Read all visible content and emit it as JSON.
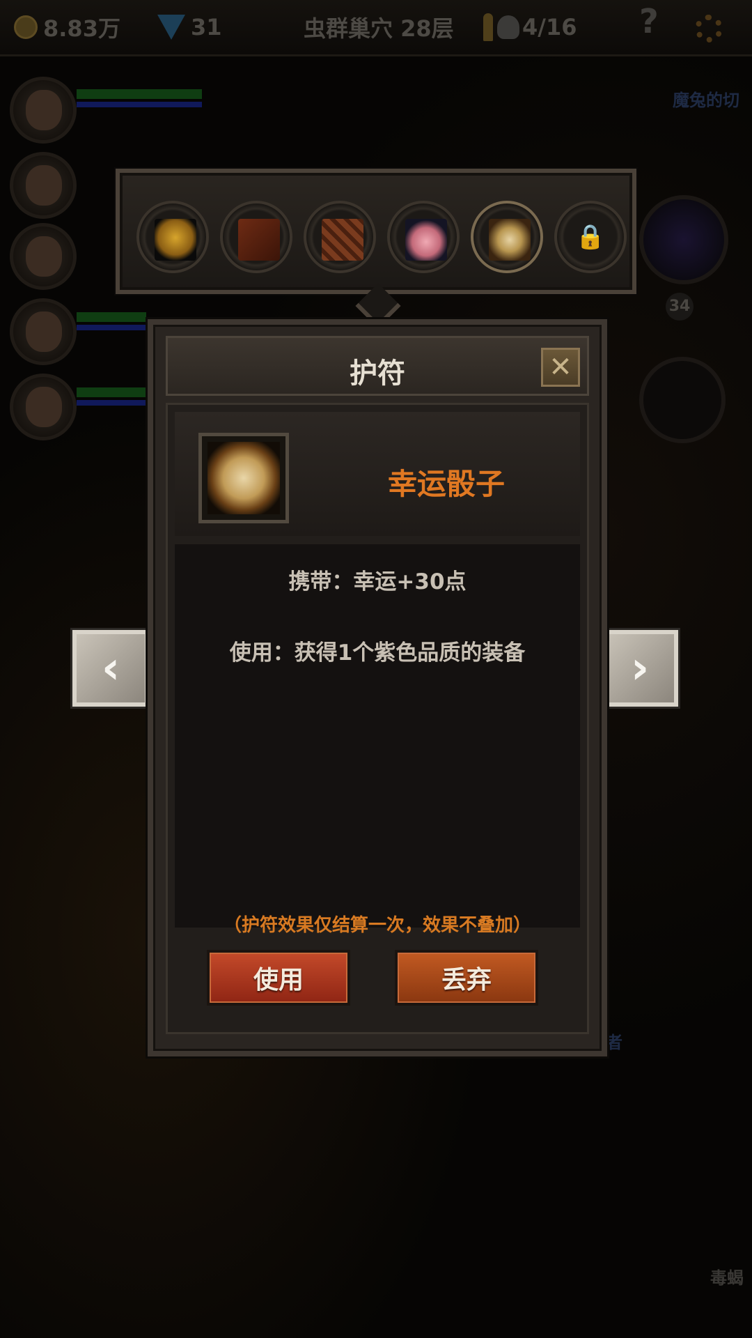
{
  "topbar": {
    "gold": "8.83万",
    "gems": "31",
    "dungeon": "虫群巢穴 28层",
    "kills": "4/16",
    "help": "?"
  },
  "background": {
    "right_text_top": "魔兔的切",
    "right_badge": "34",
    "right_text_mid": "者",
    "right_text_bottom": "毒蝎"
  },
  "amulet_slots": [
    {
      "icon": "bell-icon"
    },
    {
      "icon": "book-icon"
    },
    {
      "icon": "scale-icon"
    },
    {
      "icon": "piggy-bank-icon"
    },
    {
      "icon": "dice-icon",
      "selected": true
    },
    {
      "icon": "lock-icon",
      "locked": true
    }
  ],
  "dialog": {
    "title": "护符",
    "close": "✕",
    "item_name": "幸运骰子",
    "carry_effect": "携带：幸运+30点",
    "use_effect": "使用：获得1个紫色品质的装备",
    "note": "（护符效果仅结算一次，效果不叠加）",
    "use_button": "使用",
    "discard_button": "丢弃"
  },
  "nav": {
    "prev": "‹",
    "next": "›"
  },
  "colors": {
    "item_name": "#e07822",
    "note": "#d87a22",
    "use_button": "#c44a2a",
    "discard_button": "#c25a22"
  }
}
